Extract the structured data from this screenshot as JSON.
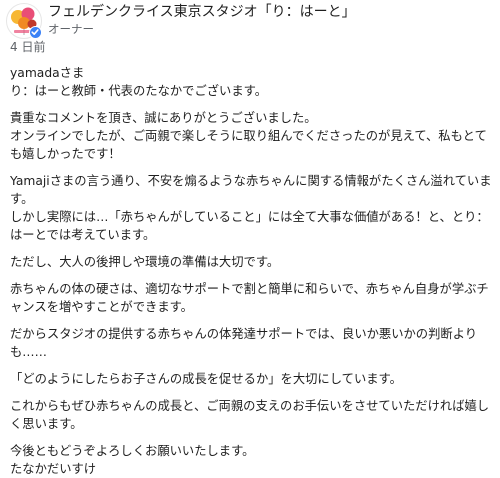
{
  "review": {
    "author": "フェルデンクライス東京スタジオ「り：はーと」",
    "role": "オーナー",
    "time": "4 日前",
    "paragraphs": [
      "yamadaさま\nり：はーと教師・代表のたなかでございます。",
      "貴重なコメントを頂き、誠にありがとうございました。\nオンラインでしたが、ご両親で楽しそうに取り組んでくださったのが見えて、私もとても嬉しかったです！",
      "Yamajiさまの言う通り、不安を煽るような赤ちゃんに関する情報がたくさん溢れています。\nしかし実際には…「赤ちゃんがしていること」には全て大事な価値がある！と、とり：はーとでは考えています。",
      "ただし、大人の後押しや環境の準備は大切です。",
      "赤ちゃんの体の硬さは、適切なサポートで割と簡単に和らいで、赤ちゃん自身が学ぶチャンスを増やすことができます。",
      "だからスタジオの提供する赤ちゃんの体発達サポートでは、良いか悪いかの判断よりも……",
      "「どのようにしたらお子さんの成長を促せるか」を大切にしています。",
      "これからもぜひ赤ちゃんの成長と、ご両親の支えのお手伝いをさせていただければ嬉しく思います。",
      "今後ともどうぞよろしくお願いいたします。\nたなかだいすけ"
    ]
  },
  "colors": {
    "text": "#1f1f1f",
    "secondary": "#5f6368",
    "verified": "#3b82f6"
  },
  "icons": {
    "avatar": "studio-logo-balloons",
    "badge": "verified-check-icon"
  }
}
